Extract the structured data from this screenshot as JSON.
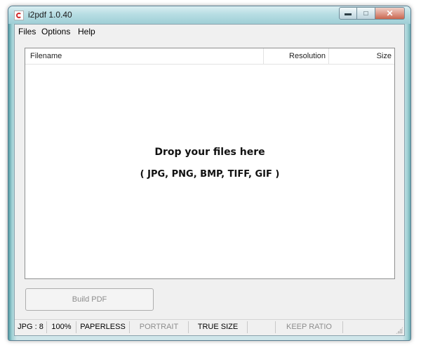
{
  "window": {
    "title": "i2pdf 1.0.40"
  },
  "menu": {
    "items": [
      "Files",
      "Options",
      "Help"
    ]
  },
  "file_list": {
    "columns": {
      "filename": "Filename",
      "resolution": "Resolution",
      "size": "Size"
    },
    "drop_message": "Drop your files here",
    "drop_types": "( JPG, PNG, BMP, TIFF, GIF )"
  },
  "build_button": {
    "label": "Build PDF"
  },
  "status": {
    "format_quality": "JPG : 8",
    "zoom": "100%",
    "paper_mode": "PAPERLESS",
    "orientation": "PORTRAIT",
    "size_mode": "TRUE SIZE",
    "ratio": "KEEP RATIO"
  },
  "icons": {
    "app": "pdf-app-icon",
    "minimize": "minimize-icon",
    "maximize": "maximize-icon",
    "close": "close-icon",
    "grip": "resize-grip-icon"
  }
}
